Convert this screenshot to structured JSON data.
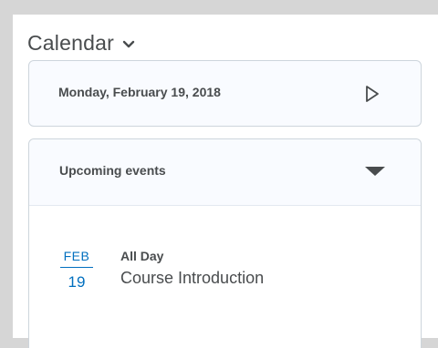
{
  "header": {
    "title": "Calendar",
    "menu_icon": "chevron-down-icon"
  },
  "date_card": {
    "date": "Monday, February 19, 2018",
    "next_icon": "play-outline-icon"
  },
  "events": {
    "label": "Upcoming events",
    "toggle_icon": "caret-down-icon",
    "items": [
      {
        "month": "FEB",
        "day": "19",
        "when": "All Day",
        "name": "Course Introduction"
      }
    ]
  },
  "colors": {
    "accent": "#006fbf",
    "text": "#494c4e",
    "border": "#cdd5dc",
    "backdrop": "#d6d6d6"
  }
}
